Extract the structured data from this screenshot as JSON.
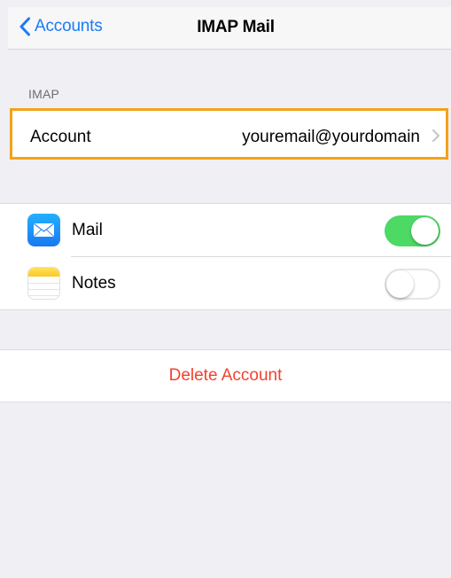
{
  "nav": {
    "back_label": "Accounts",
    "title": "IMAP Mail"
  },
  "section": {
    "header": "IMAP"
  },
  "account": {
    "label": "Account",
    "value": "youremail@yourdomain"
  },
  "toggles": [
    {
      "label": "Mail",
      "icon": "mail-icon",
      "enabled": true
    },
    {
      "label": "Notes",
      "icon": "notes-icon",
      "enabled": false
    }
  ],
  "delete": {
    "label": "Delete Account"
  },
  "colors": {
    "accent_blue": "#1a7cf5",
    "toggle_on": "#4cd964",
    "destructive": "#f5412f",
    "highlight": "#f3a21b",
    "background": "#efeff4"
  }
}
